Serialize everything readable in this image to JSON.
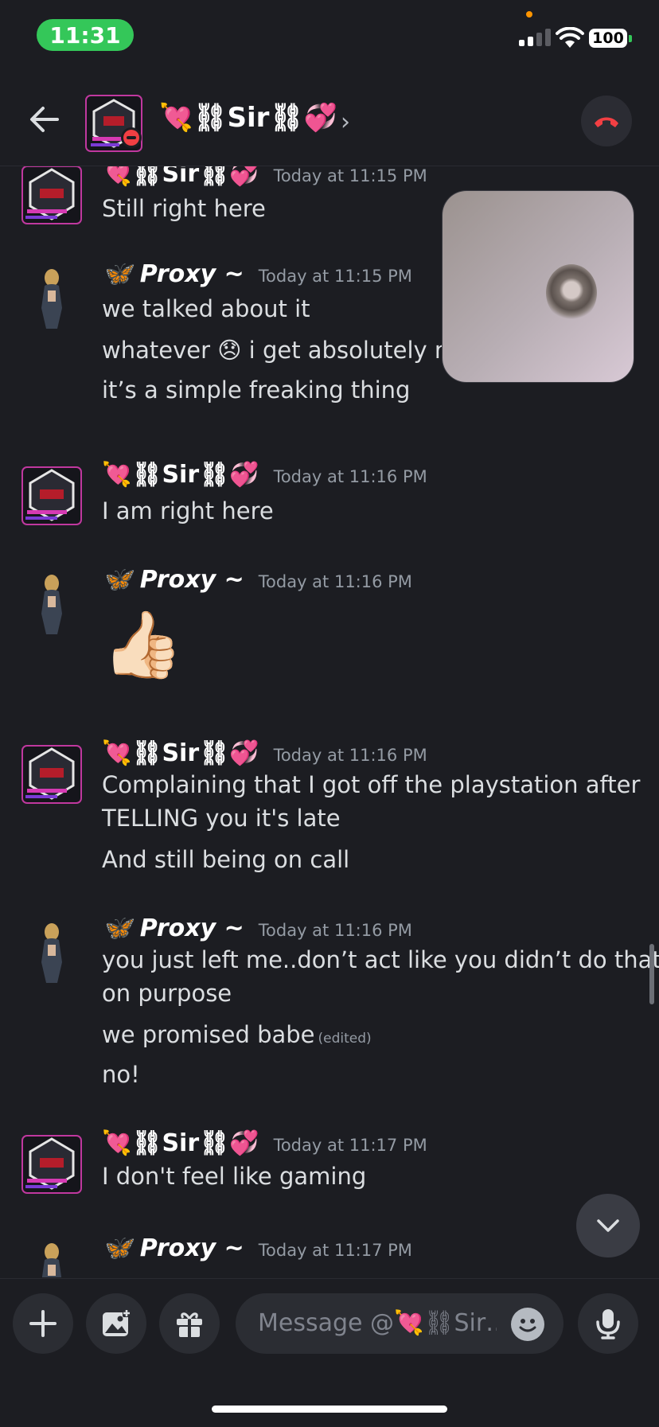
{
  "status_bar": {
    "time": "11:31",
    "battery": "100"
  },
  "header": {
    "name": "💘⛓Sir⛓💞",
    "chevron": "›"
  },
  "messages": [
    {
      "author": "💘⛓Sir⛓💞",
      "timestamp": "Today at 11:15 PM",
      "lines": [
        "Still right here"
      ]
    },
    {
      "author": "🦋 Proxy ~",
      "timestamp": "Today at 11:15 PM",
      "lines": [
        "we talked about it",
        "whatever 😞 i get absolutely no r",
        "it’s a simple freaking thing"
      ]
    },
    {
      "author": "💘⛓Sir⛓💞",
      "timestamp": "Today at 11:16 PM",
      "lines": [
        "I am right here"
      ]
    },
    {
      "author": "🦋 Proxy ~",
      "timestamp": "Today at 11:16 PM",
      "lines": [
        "👍🏻"
      ]
    },
    {
      "author": "💘⛓Sir⛓💞",
      "timestamp": "Today at 11:16 PM",
      "lines": [
        "Complaining that I got off the playstation after",
        "TELLING you it's late",
        "And still being on call"
      ]
    },
    {
      "author": "🦋 Proxy ~",
      "timestamp": "Today at 11:16 PM",
      "lines": [
        "you just left me..don’t act like you didn’t do that",
        "on purpose",
        "we promised babe",
        "no!"
      ],
      "edited_label": "(edited)"
    },
    {
      "author": "💘⛓Sir⛓💞",
      "timestamp": "Today at 11:17 PM",
      "lines": [
        "I don't feel like gaming"
      ]
    },
    {
      "author": "🦋 Proxy ~",
      "timestamp": "Today at 11:17 PM",
      "lines": []
    }
  ],
  "composer": {
    "placeholder": "Message @💘⛓Sir…"
  },
  "colors": {
    "background": "#1c1d22",
    "end_call_red": "#f23f43",
    "status_green": "#34c759"
  }
}
